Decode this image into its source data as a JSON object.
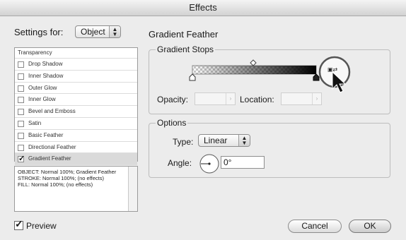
{
  "window": {
    "title": "Effects"
  },
  "settings": {
    "label": "Settings for:",
    "value": "Object"
  },
  "effects_list": {
    "header": "Transparency",
    "items": [
      {
        "label": "Drop Shadow",
        "checked": false
      },
      {
        "label": "Inner Shadow",
        "checked": false
      },
      {
        "label": "Outer Glow",
        "checked": false
      },
      {
        "label": "Inner Glow",
        "checked": false
      },
      {
        "label": "Bevel and Emboss",
        "checked": false
      },
      {
        "label": "Satin",
        "checked": false
      },
      {
        "label": "Basic Feather",
        "checked": false
      },
      {
        "label": "Directional Feather",
        "checked": false
      },
      {
        "label": "Gradient Feather",
        "checked": true
      }
    ]
  },
  "summary": {
    "lines": [
      "OBJECT: Normal 100%; Gradient Feather",
      "STROKE: Normal 100%; (no effects)",
      "FILL: Normal 100%; (no effects)"
    ]
  },
  "preview": {
    "label": "Preview",
    "checked": true
  },
  "panel": {
    "title": "Gradient Feather",
    "gradient_stops": {
      "title": "Gradient Stops",
      "opacity_label": "Opacity:",
      "location_label": "Location:"
    },
    "options": {
      "title": "Options",
      "type_label": "Type:",
      "type_value": "Linear",
      "angle_label": "Angle:",
      "angle_value": "0°"
    }
  },
  "buttons": {
    "cancel": "Cancel",
    "ok": "OK"
  },
  "colors": {
    "highlight_row": "#dadada",
    "callout_ring": "#555555"
  }
}
